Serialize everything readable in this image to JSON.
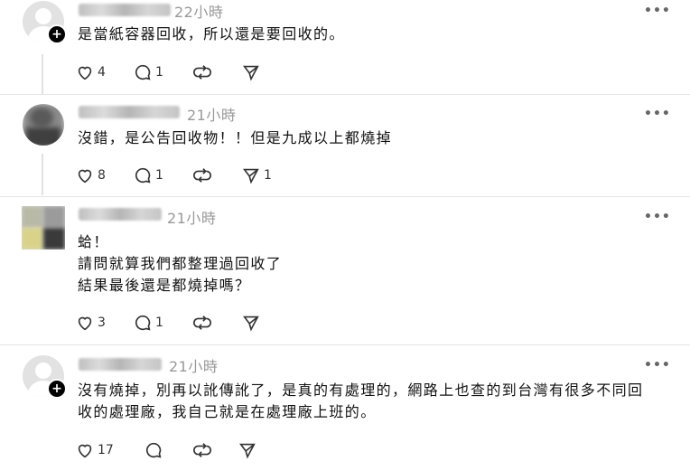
{
  "posts": [
    {
      "time": "22小時",
      "lines": [
        "是當紙容器回收，所以還是要回收的。"
      ],
      "likes": "4",
      "comments": "1",
      "reposts": "",
      "shares": ""
    },
    {
      "time": "21小時",
      "lines": [
        "沒錯，是公告回收物！！但是九成以上都燒掉"
      ],
      "likes": "8",
      "comments": "1",
      "reposts": "",
      "shares": "1"
    },
    {
      "time": "21小時",
      "lines": [
        "蛤！",
        "請問就算我們都整理過回收了",
        "結果最後還是都燒掉嗎？"
      ],
      "likes": "3",
      "comments": "1",
      "reposts": "",
      "shares": ""
    },
    {
      "time": "21小時",
      "lines": [
        "沒有燒掉，別再以訛傳訛了，是真的有處理的，網路上也查的到台灣有很多不同回",
        "收的處理廠，我自己就是在處理廠上班的。"
      ],
      "likes": "17",
      "comments": "",
      "reposts": "",
      "shares": ""
    }
  ],
  "icons": {
    "like": "heart-icon",
    "comment": "comment-bubble-icon",
    "repost": "repost-icon",
    "share": "send-icon",
    "more": "more-options-icon",
    "follow": "follow-plus-icon"
  },
  "more_label": "•••",
  "follow_label": "+"
}
